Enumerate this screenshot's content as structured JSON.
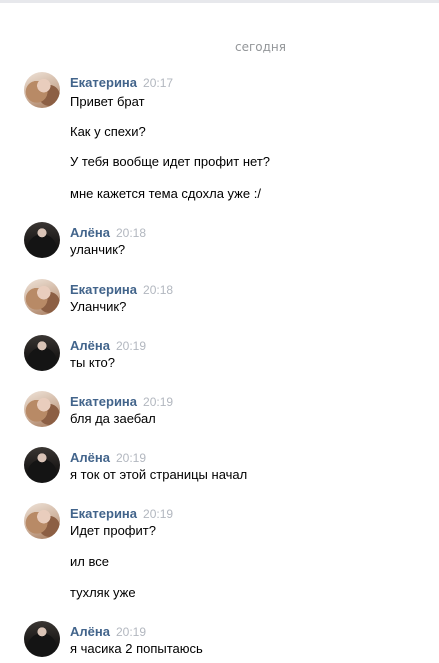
{
  "date_separator": "сегодня",
  "messages": [
    {
      "author": "Екатерина",
      "time": "20:17",
      "lines": [
        "Привет брат",
        "Как у спехи?",
        "У тебя вообще идет профит нет?",
        "мне кажется тема сдохла уже :/"
      ]
    },
    {
      "author": "Алёна",
      "time": "20:18",
      "lines": [
        "уланчик?"
      ]
    },
    {
      "author": "Екатерина",
      "time": "20:18",
      "lines": [
        "Уланчик?"
      ]
    },
    {
      "author": "Алёна",
      "time": "20:19",
      "lines": [
        "ты кто?"
      ]
    },
    {
      "author": "Екатерина",
      "time": "20:19",
      "lines": [
        "бля да заебал"
      ]
    },
    {
      "author": "Алёна",
      "time": "20:19",
      "lines": [
        "я ток от этой страницы начал"
      ]
    },
    {
      "author": "Екатерина",
      "time": "20:19",
      "lines": [
        "Идет профит?",
        "ил все",
        "тухляк уже"
      ]
    },
    {
      "author": "Алёна",
      "time": "20:19",
      "lines": [
        "я часика 2 попытаюсь"
      ]
    }
  ]
}
